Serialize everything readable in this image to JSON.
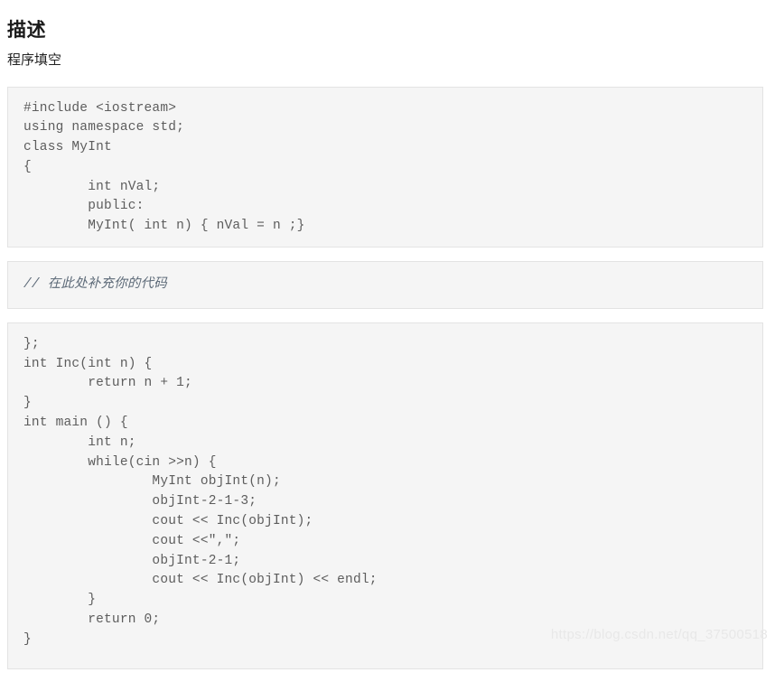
{
  "header": {
    "title": "描述",
    "section_label": "程序填空"
  },
  "code_blocks": {
    "block1": {
      "name": "class-definition-code",
      "lines": [
        "#include <iostream>",
        "using namespace std;",
        "class MyInt",
        "{",
        "        int nVal;",
        "        public:",
        "        MyInt( int n) { nVal = n ;}"
      ]
    },
    "block2": {
      "name": "fill-in-the-blank-placeholder",
      "lines": [
        "// 在此处补充你的代码"
      ]
    },
    "block3": {
      "name": "main-function-code",
      "lines": [
        "};",
        "int Inc(int n) {",
        "        return n + 1;",
        "}",
        "int main () {",
        "        int n;",
        "        while(cin >>n) {",
        "                MyInt objInt(n);",
        "                objInt-2-1-3;",
        "                cout << Inc(objInt);",
        "                cout <<\",\";",
        "                objInt-2-1;",
        "                cout << Inc(objInt) << endl;",
        "        }",
        "        return 0;",
        "}"
      ]
    }
  },
  "watermark": {
    "text": "https://blog.csdn.net/qq_37500518"
  },
  "colors": {
    "code_background": "#f5f5f5",
    "code_border": "#e3e3e3",
    "code_text": "#5d5d5d",
    "comment_text": "#5d6a78",
    "title_text": "#1a1a1a",
    "watermark_text": "#e8e8e8"
  }
}
